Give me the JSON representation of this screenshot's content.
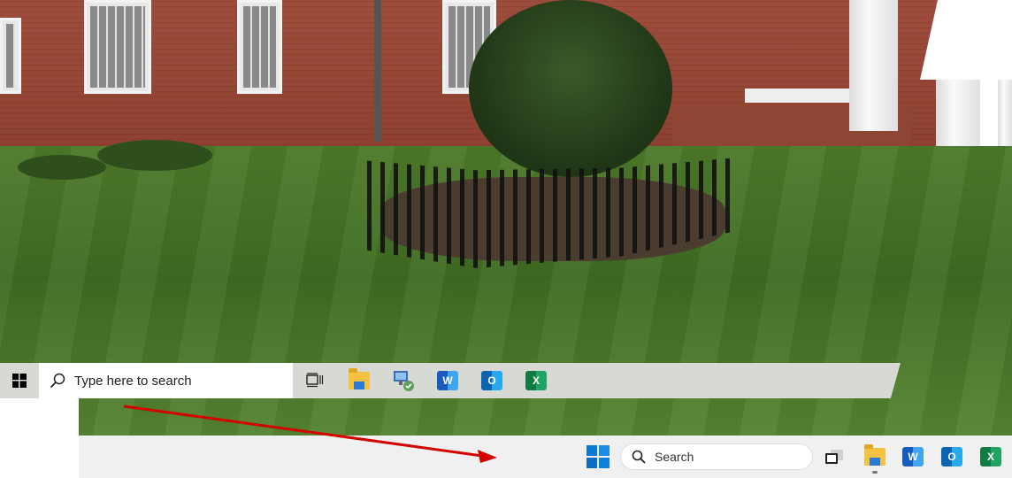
{
  "win10_taskbar": {
    "search_placeholder": "Type here to search",
    "icons": [
      "windows-logo-icon",
      "task-view-icon",
      "file-explorer-icon",
      "network-app-icon",
      "word-icon",
      "outlook-icon",
      "excel-icon"
    ]
  },
  "win11_taskbar": {
    "search_placeholder": "Search",
    "icons": [
      "windows11-start-icon",
      "search-icon",
      "task-view-icon",
      "file-explorer-icon",
      "word-icon",
      "outlook-icon",
      "excel-icon"
    ]
  },
  "annotation": {
    "arrow_color": "#d40000"
  },
  "colors": {
    "win10_taskbar_bg": "#e1e1e1",
    "win11_taskbar_bg": "#f0f0f0",
    "win11_accent": "#0078d4"
  }
}
